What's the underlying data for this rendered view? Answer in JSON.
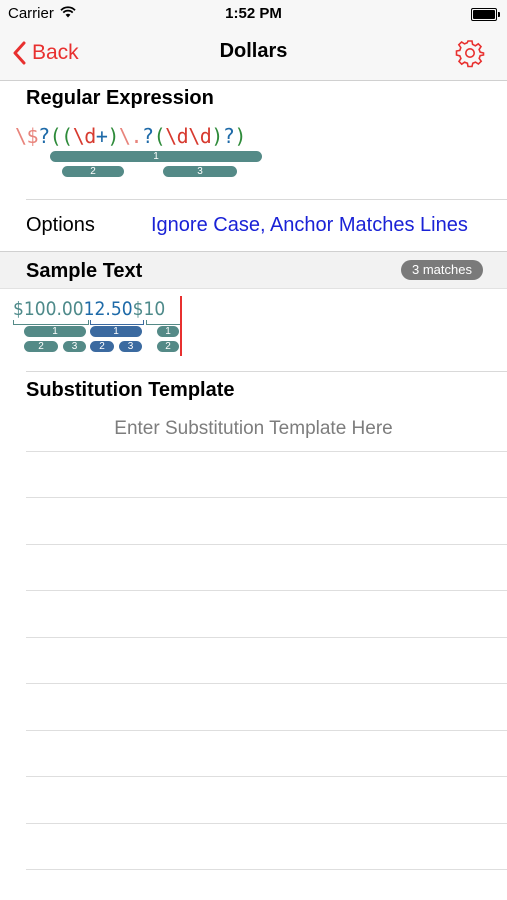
{
  "status_bar": {
    "carrier": "Carrier",
    "time": "1:52 PM"
  },
  "nav": {
    "back_label": "Back",
    "title": "Dollars"
  },
  "regex": {
    "section_title": "Regular Expression",
    "tokens": [
      {
        "text": "\\$",
        "color": "red-light"
      },
      {
        "text": "?",
        "color": "blue"
      },
      {
        "text": "((",
        "color": "green"
      },
      {
        "text": "\\d",
        "color": "red"
      },
      {
        "text": "+",
        "color": "blue"
      },
      {
        "text": ")",
        "color": "green"
      },
      {
        "text": "\\.",
        "color": "red-light"
      },
      {
        "text": "?",
        "color": "blue"
      },
      {
        "text": "(",
        "color": "green"
      },
      {
        "text": "\\d\\d",
        "color": "red"
      },
      {
        "text": ")",
        "color": "green"
      },
      {
        "text": "?",
        "color": "blue"
      },
      {
        "text": ")",
        "color": "green"
      }
    ],
    "groups": [
      "1",
      "2",
      "3"
    ]
  },
  "options": {
    "label": "Options",
    "value": "Ignore Case, Anchor Matches Lines"
  },
  "sample": {
    "section_title": "Sample Text",
    "matches_badge": "3 matches",
    "matches": [
      {
        "text": "$100.00",
        "color": "teal",
        "groups": [
          "1",
          "2",
          "3"
        ]
      },
      {
        "text": "12.50",
        "color": "blue",
        "groups": [
          "1",
          "2",
          "3"
        ]
      },
      {
        "text": "$10",
        "color": "teal",
        "groups": [
          "1",
          "2"
        ]
      }
    ]
  },
  "substitution": {
    "section_title": "Substitution Template",
    "placeholder": "Enter Substitution Template Here"
  },
  "colors": {
    "accent": "#e8302f",
    "link": "#1a22d6",
    "group_pill": "#548a87",
    "group_pill_alt": "#3b6aa0"
  }
}
